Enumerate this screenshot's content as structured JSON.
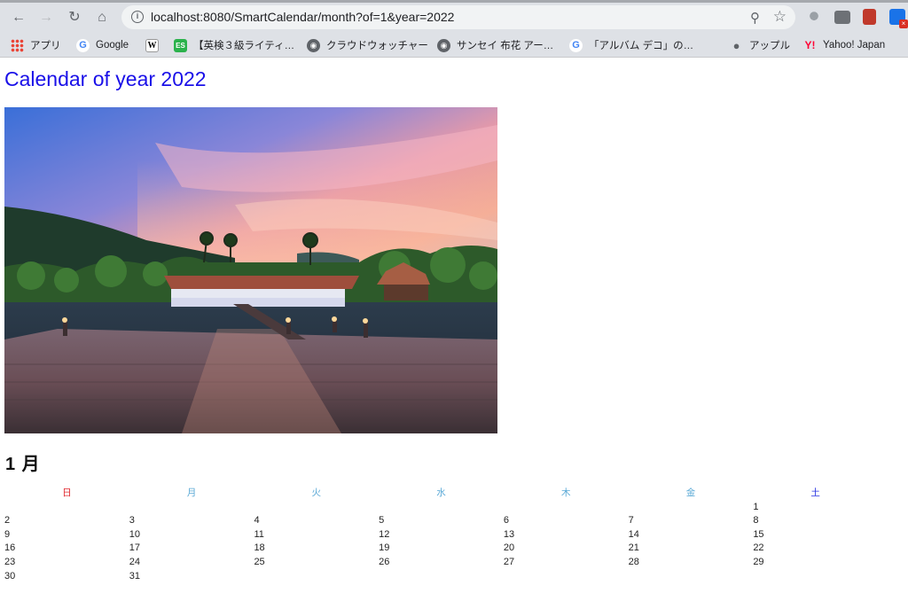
{
  "browser": {
    "url": "localhost:8080/SmartCalendar/month?of=1&year=2022",
    "bookmarks": [
      {
        "label": "アプリ",
        "icon": "apps-icon"
      },
      {
        "label": "Google",
        "icon": "google-icon"
      },
      {
        "label": "",
        "icon": "wikipedia-icon"
      },
      {
        "label": "【英検３級ライティ…",
        "icon": "eiken-icon"
      },
      {
        "label": "クラウドウォッチャー",
        "icon": "globe-icon"
      },
      {
        "label": "サンセイ 布花 アー…",
        "icon": "globe-icon"
      },
      {
        "label": "「アルバム デコ」の…",
        "icon": "google-icon"
      },
      {
        "label": "",
        "icon": "calendar-site-icon"
      },
      {
        "label": "アップル",
        "icon": "apple-icon"
      },
      {
        "label": "Yahoo! Japan",
        "icon": "yahoo-icon"
      }
    ]
  },
  "page": {
    "title": "Calendar of year 2022",
    "month_title": "1 月",
    "weekdays": [
      "日",
      "月",
      "火",
      "水",
      "木",
      "金",
      "土"
    ],
    "weeks": [
      [
        "",
        "",
        "",
        "",
        "",
        "",
        "1"
      ],
      [
        "2",
        "3",
        "4",
        "5",
        "6",
        "7",
        "8"
      ],
      [
        "9",
        "10",
        "11",
        "12",
        "13",
        "14",
        "15"
      ],
      [
        "16",
        "17",
        "18",
        "19",
        "20",
        "21",
        "22"
      ],
      [
        "23",
        "24",
        "25",
        "26",
        "27",
        "28",
        "29"
      ],
      [
        "30",
        "31",
        "",
        "",
        "",
        "",
        ""
      ]
    ]
  },
  "colors": {
    "title": "#1a10e8",
    "sunday": "#e0252b",
    "weekday": "#5aa9d6",
    "saturday": "#2430e0"
  }
}
